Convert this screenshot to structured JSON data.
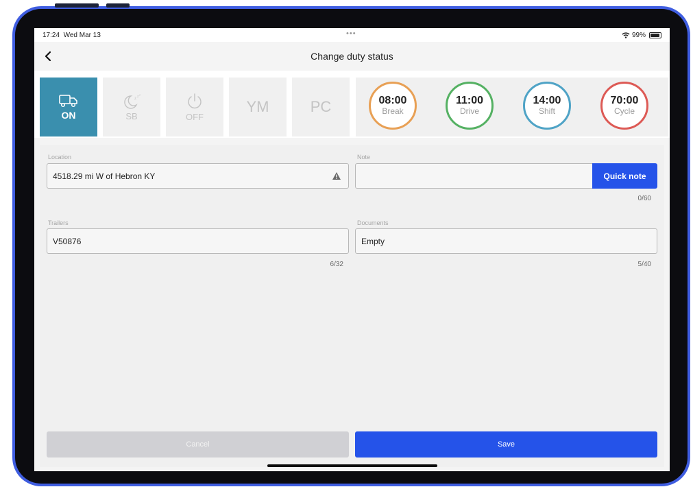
{
  "status_bar": {
    "time": "17:24",
    "date": "Wed Mar 13",
    "dots": "•••",
    "battery": "99%",
    "wifi_icon": "wifi-icon",
    "battery_icon": "battery-icon"
  },
  "header": {
    "title": "Change duty status",
    "back_icon": "chevron-left-icon"
  },
  "duty_statuses": [
    {
      "id": "on",
      "label": "ON",
      "icon": "truck-icon",
      "active": true
    },
    {
      "id": "sb",
      "label": "SB",
      "icon": "moon-sleep-icon",
      "active": false
    },
    {
      "id": "off",
      "label": "OFF",
      "icon": "power-icon",
      "active": false
    },
    {
      "id": "ym",
      "label": "YM",
      "active": false
    },
    {
      "id": "pc",
      "label": "PC",
      "active": false
    }
  ],
  "timers": [
    {
      "value": "08:00",
      "label": "Break",
      "color": "#e8a055"
    },
    {
      "value": "11:00",
      "label": "Drive",
      "color": "#55b163"
    },
    {
      "value": "14:00",
      "label": "Shift",
      "color": "#4fa3c6"
    },
    {
      "value": "70:00",
      "label": "Cycle",
      "color": "#dd5a55"
    }
  ],
  "form": {
    "location": {
      "label": "Location",
      "value": "4518.29 mi W of Hebron KY",
      "icon": "warning-icon"
    },
    "note": {
      "label": "Note",
      "value": "",
      "counter": "0/60",
      "quick_note_label": "Quick note"
    },
    "trailers": {
      "label": "Trailers",
      "value": "V50876",
      "counter": "6/32"
    },
    "documents": {
      "label": "Documents",
      "value": "Empty",
      "counter": "5/40"
    }
  },
  "actions": {
    "cancel_label": "Cancel",
    "save_label": "Save"
  },
  "colors": {
    "accent": "#2553e9",
    "active_status": "#3a8fae",
    "device_outline": "#3f5de0"
  }
}
